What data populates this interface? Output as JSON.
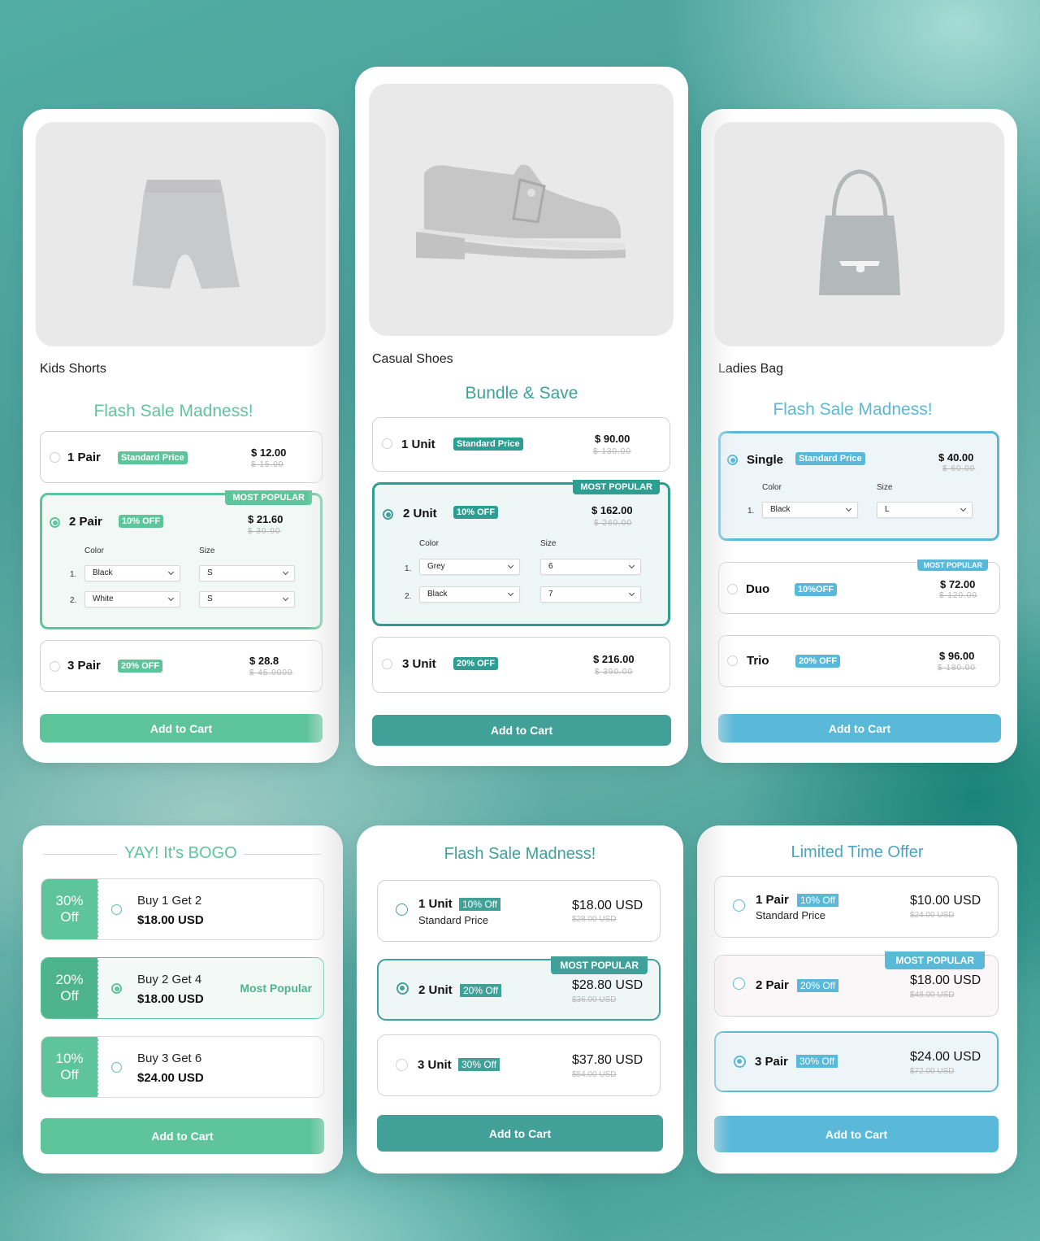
{
  "colors": {
    "green": "#5ec49c",
    "teal": "#3fa199",
    "blue": "#5ab8d8"
  },
  "cards": [
    {
      "product_name": "Kids Shorts",
      "title": "Flash Sale Madness!",
      "image": "shorts-image",
      "options": [
        {
          "label": "1 Pair",
          "badge": "Standard Price",
          "price": "$ 12.00",
          "old_price": "$ 15.00",
          "selected": false
        },
        {
          "label": "2 Pair",
          "badge": "10% OFF",
          "price": "$ 21.60",
          "old_price": "$ 30.00",
          "selected": true,
          "ribbon": "MOST POPULAR",
          "color_label": "Color",
          "size_label": "Size",
          "rows": [
            {
              "num": "1.",
              "color": "Black",
              "size": "S"
            },
            {
              "num": "2.",
              "color": "White",
              "size": "S"
            }
          ]
        },
        {
          "label": "3 Pair",
          "badge": "20% OFF",
          "price": "$ 28.8",
          "old_price": "$ 45.0000",
          "selected": false
        }
      ],
      "cta": "Add to Cart"
    },
    {
      "product_name": "Casual Shoes",
      "title": "Bundle & Save",
      "image": "shoe-image",
      "options": [
        {
          "label": "1 Unit",
          "badge": "Standard Price",
          "price": "$ 90.00",
          "old_price": "$ 130.00",
          "selected": false
        },
        {
          "label": "2 Unit",
          "badge": "10% OFF",
          "price": "$ 162.00",
          "old_price": "$ 260.00",
          "selected": true,
          "ribbon": "MOST POPULAR",
          "color_label": "Color",
          "size_label": "Size",
          "rows": [
            {
              "num": "1.",
              "color": "Grey",
              "size": "6"
            },
            {
              "num": "2.",
              "color": "Black",
              "size": "7"
            }
          ]
        },
        {
          "label": "3 Unit",
          "badge": "20% OFF",
          "price": "$ 216.00",
          "old_price": "$ 390.00",
          "selected": false
        }
      ],
      "cta": "Add to Cart"
    },
    {
      "product_name": "Ladies Bag",
      "title": "Flash Sale Madness!",
      "image": "handbag-image",
      "options": [
        {
          "label": "Single",
          "badge": "Standard Price",
          "price": "$ 40.00",
          "old_price": "$ 60.00",
          "selected": true,
          "color_label": "Color",
          "size_label": "Size",
          "rows": [
            {
              "num": "1.",
              "color": "Black",
              "size": "L"
            }
          ]
        },
        {
          "label": "Duo",
          "badge": "10%OFF",
          "price": "$ 72.00",
          "old_price": "$ 120.00",
          "selected": false,
          "ribbon": "MOST POPULAR"
        },
        {
          "label": "Trio",
          "badge": "20% OFF",
          "price": "$ 96.00",
          "old_price": "$ 180.00",
          "selected": false
        }
      ],
      "cta": "Add to Cart"
    },
    {
      "title": "YAY! It's BOGO",
      "options": [
        {
          "discount_line1": "30%",
          "discount_line2": "Off",
          "label": "Buy 1 Get 2",
          "price": "$18.00 USD",
          "selected": false
        },
        {
          "discount_line1": "20%",
          "discount_line2": "Off",
          "label": "Buy 2 Get 4",
          "price": "$18.00 USD",
          "selected": true,
          "tag": "Most Popular"
        },
        {
          "discount_line1": "10%",
          "discount_line2": "Off",
          "label": "Buy 3 Get 6",
          "price": "$24.00 USD",
          "selected": false
        }
      ],
      "cta": "Add to Cart"
    },
    {
      "title": "Flash Sale Madness!",
      "options": [
        {
          "label": "1 Unit",
          "badge": "10% Off",
          "subtitle": "Standard Price",
          "price": "$18.00 USD",
          "old_price": "$28.00 USD",
          "selected": false
        },
        {
          "label": "2 Unit",
          "badge": "20% Off",
          "price": "$28.80 USD",
          "old_price": "$36.00 USD",
          "selected": true,
          "ribbon": "MOST POPULAR"
        },
        {
          "label": "3 Unit",
          "badge": "30% Off",
          "price": "$37.80 USD",
          "old_price": "$54.00 USD",
          "selected": false
        }
      ],
      "cta": "Add to Cart"
    },
    {
      "title": "Limited Time Offer",
      "options": [
        {
          "label": "1 Pair",
          "badge": "10% Off",
          "subtitle": "Standard Price",
          "price": "$10.00 USD",
          "old_price": "$24.00 USD",
          "selected": false
        },
        {
          "label": "2 Pair",
          "badge": "20% Off",
          "price": "$18.00 USD",
          "old_price": "$48.00 USD",
          "selected": false,
          "ribbon": "MOST POPULAR"
        },
        {
          "label": "3 Pair",
          "badge": "30% Off",
          "price": "$24.00 USD",
          "old_price": "$72.00 USD",
          "selected": true
        }
      ],
      "cta": "Add to Cart"
    }
  ]
}
